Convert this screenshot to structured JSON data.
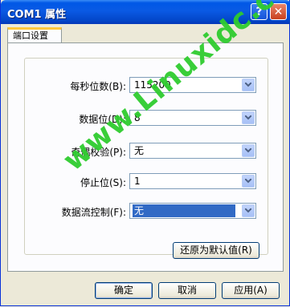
{
  "window": {
    "title": "COM1 属性"
  },
  "titlebar_buttons": {
    "help": "?",
    "close": "✕"
  },
  "tabs": [
    {
      "label": "端口设置"
    }
  ],
  "fields": [
    {
      "label": "每秒位数(B):",
      "value": "115200"
    },
    {
      "label": "数据位(D):",
      "value": "8"
    },
    {
      "label": "奇偶校验(P):",
      "value": "无"
    },
    {
      "label": "停止位(S):",
      "value": "1"
    },
    {
      "label": "数据流控制(F):",
      "value": "无"
    }
  ],
  "restore_button": "还原为默认值(R)",
  "footer": {
    "ok": "确定",
    "cancel": "取消",
    "apply": "应用(A)"
  },
  "watermark": "www.Linuxidc.com",
  "colors": {
    "titlebar": "#0058e6",
    "selection": "#316ac5",
    "watermark": "#2fcc2f"
  }
}
